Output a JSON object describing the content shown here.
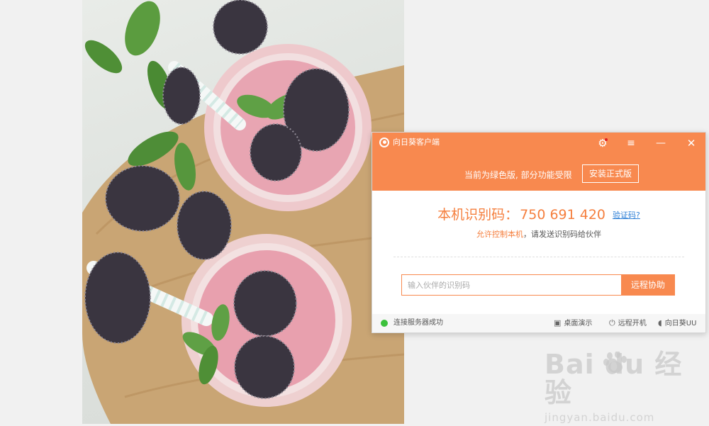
{
  "app": {
    "title": "向日葵客户端"
  },
  "titlebar": {
    "settings_icon": "gear-icon",
    "menu_glyph": "≡",
    "minimize_glyph": "—",
    "close_glyph": "✕",
    "notice": "当前为绿色版, 部分功能受限",
    "install_label": "安装正式版"
  },
  "main": {
    "id_label": "本机识别码：",
    "id_value": "750 691 420",
    "verify_link": "验证码?",
    "allow_highlight": "允许控制本机",
    "allow_rest": "，请发送识别码给伙伴",
    "partner_placeholder": "输入伙伴的识别码",
    "remote_button": "远程协助"
  },
  "statusbar": {
    "status_text": "连接服务器成功",
    "status_color": "#3cc13c",
    "desktop_demo": "桌面演示",
    "remote_boot": "远程开机",
    "sunflower_uu": "向日葵UU"
  },
  "watermark": {
    "main": "Bai du 经验",
    "sub": "jingyan.baidu.com"
  },
  "colors": {
    "accent": "#f8894f",
    "id_text": "#f57f3e",
    "link": "#2d7fd6"
  }
}
